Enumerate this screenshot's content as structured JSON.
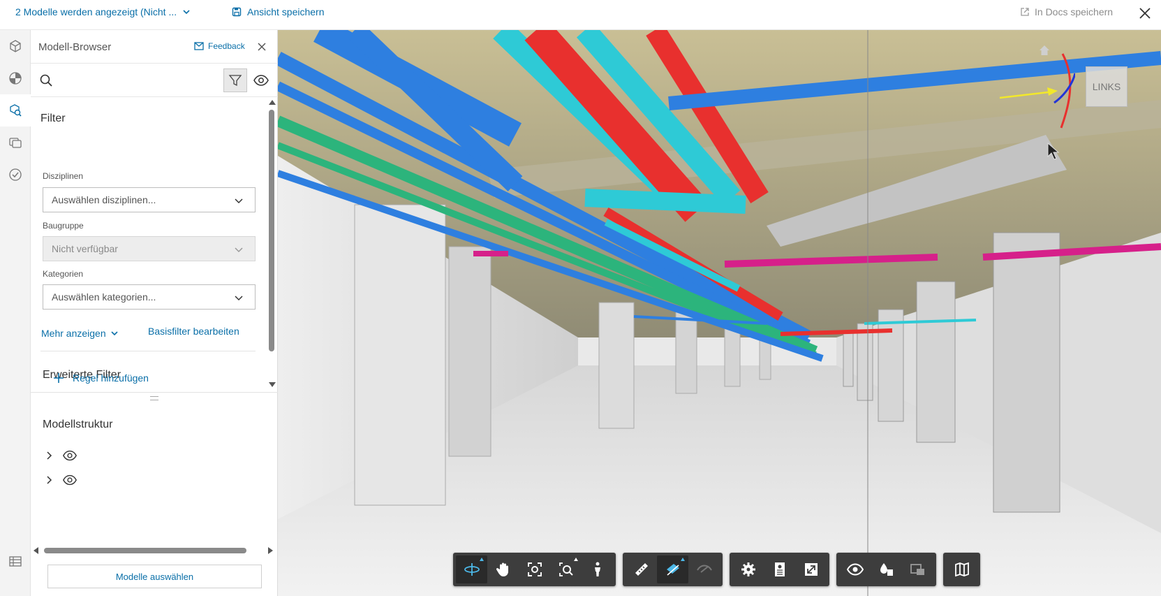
{
  "topbar": {
    "model_select": "2 Modelle werden angezeigt (Nicht ...",
    "save_view": "Ansicht speichern",
    "docs_save": "In Docs speichern"
  },
  "panel": {
    "title": "Modell-Browser",
    "feedback": "Feedback",
    "search_placeholder": "",
    "filter_heading": "Filter",
    "fields": {
      "disciplines_label": "Disziplinen",
      "disciplines_value": "Auswählen disziplinen...",
      "assembly_label": "Baugruppe",
      "assembly_value": "Nicht verfügbar",
      "categories_label": "Kategorien",
      "categories_value": "Auswählen kategorien..."
    },
    "more_link": "Mehr anzeigen",
    "base_filter_link": "Basisfilter bearbeiten",
    "advanced_heading": "Erweiterte Filter",
    "add_rule": "Regel hinzufügen",
    "structure_heading": "Modellstruktur",
    "models_button": "Modelle auswählen"
  },
  "viewcube": {
    "face_label": "LINKS"
  },
  "icons": {
    "rail": [
      "cube-icon",
      "sphere-icon",
      "model-browser-icon",
      "layers-icon",
      "check-circle-icon",
      "table-icon"
    ],
    "toolbar": [
      "orbit-icon",
      "pan-icon",
      "fit-view-icon",
      "zoom-window-icon",
      "walk-icon",
      "measure-icon",
      "section-icon",
      "hide-icon",
      "settings-icon",
      "properties-icon",
      "fullscreen-icon",
      "visibility-icon",
      "explode-icon",
      "model-swap-icon",
      "map-icon"
    ]
  },
  "colors": {
    "accent": "#0a6fa8",
    "toolbar_bg": "#3d3d3d",
    "toolbar_active": "#4cb8e8",
    "pipe_blue": "#2e7fe0",
    "pipe_red": "#e8302e",
    "pipe_cyan": "#2ecad6",
    "pipe_green": "#2cb47c",
    "pipe_magenta": "#d6208a"
  }
}
